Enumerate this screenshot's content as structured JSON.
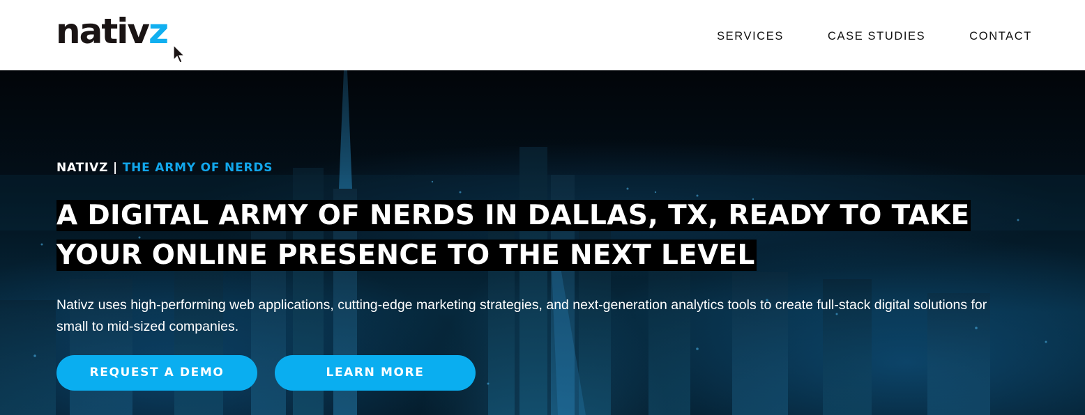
{
  "brand": {
    "logo_main": "nativ",
    "logo_accent": "z",
    "accent_color": "#11aff0"
  },
  "nav": {
    "items": [
      "SERVICES",
      "CASE STUDIES",
      "CONTACT"
    ]
  },
  "hero": {
    "eyebrow_main": "NATIVZ | ",
    "eyebrow_accent": "THE ARMY OF NERDS",
    "headline": "A DIGITAL ARMY OF NERDS IN DALLAS, TX, READY TO TAKE YOUR ONLINE PRESENCE TO THE NEXT LEVEL",
    "description": "Nativz uses high-performing web applications, cutting-edge marketing strategies, and next-generation analytics tools to create full-stack digital solutions for small to mid-sized companies.",
    "primary_button": "REQUEST A DEMO",
    "secondary_button": "LEARN MORE",
    "background": "night-city-skyline-image"
  }
}
